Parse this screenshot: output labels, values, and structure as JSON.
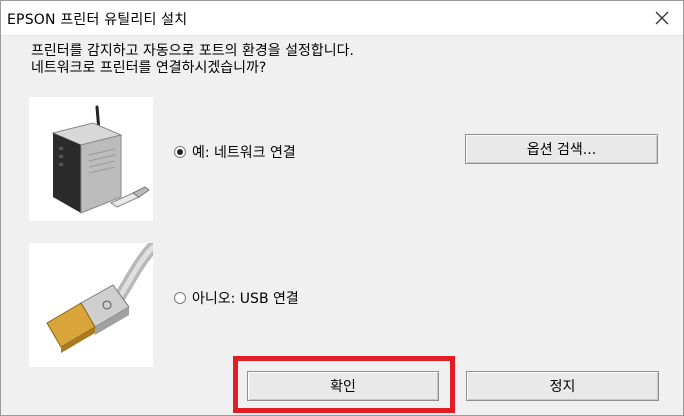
{
  "window": {
    "title": "EPSON 프린터 유틸리티 설치",
    "close_icon": "close-icon"
  },
  "prompt": {
    "line1": "프린터를 감지하고 자동으로 포트의 환경을 설정합니다.",
    "line2": "네트워크로 프린터를 연결하시겠습니까?"
  },
  "options": {
    "network": {
      "label": "예: 네트워크 연결",
      "selected": true,
      "image_icon": "network-router-icon"
    },
    "usb": {
      "label": "아니오: USB 연결",
      "selected": false,
      "image_icon": "usb-cable-icon"
    }
  },
  "buttons": {
    "option_search": "옵션 검색...",
    "ok": "확인",
    "stop": "정지"
  },
  "colors": {
    "highlight": "#e11d26",
    "window_bg": "#f0f0f0"
  }
}
